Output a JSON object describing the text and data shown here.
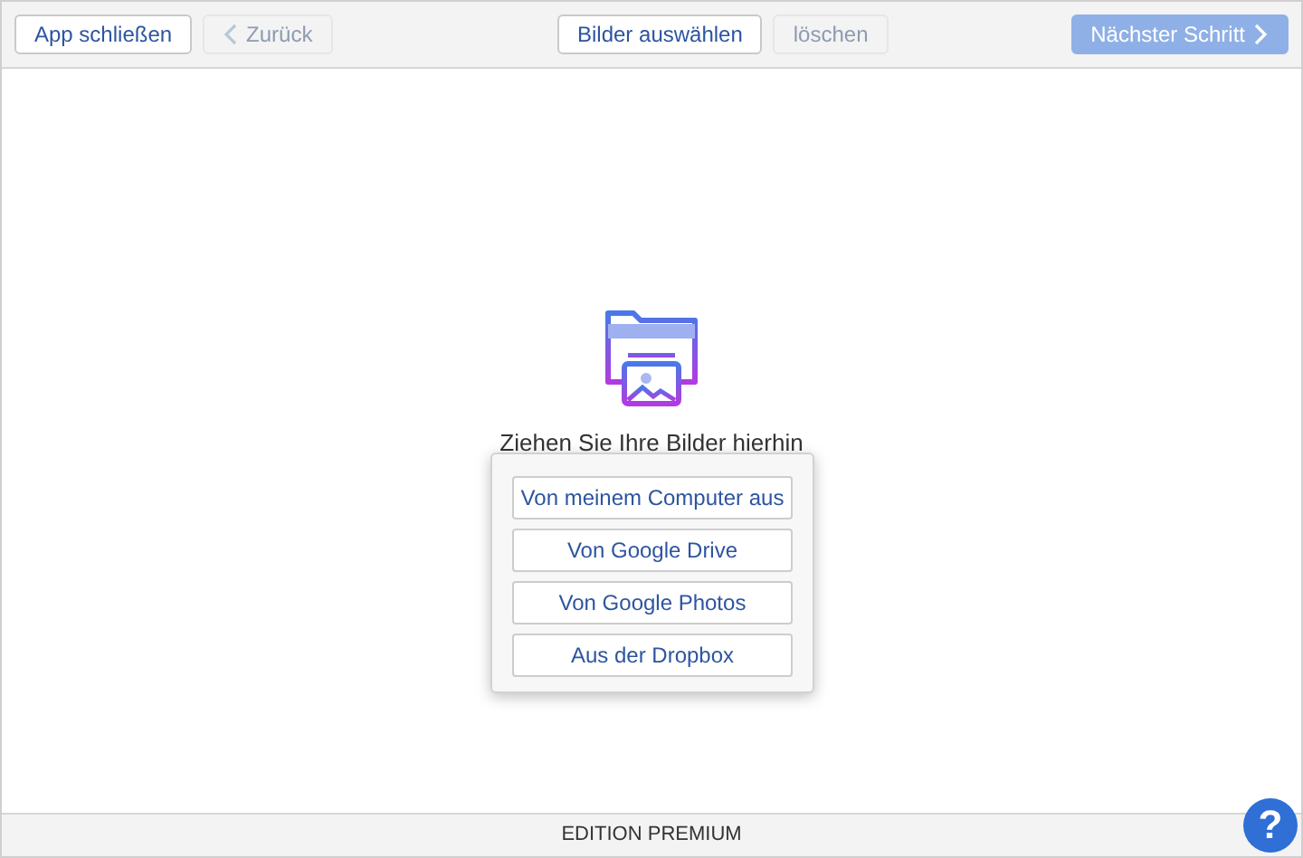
{
  "toolbar": {
    "left": [
      {
        "label": "App schließen",
        "disabled": false
      },
      {
        "label": "Zurück",
        "disabled": true,
        "kind": "back"
      }
    ],
    "center": [
      {
        "label": "Bilder auswählen",
        "disabled": false
      },
      {
        "label": "löschen",
        "disabled": true
      }
    ],
    "right": [
      {
        "label": "Nächster Schritt",
        "disabled": true,
        "kind": "next"
      }
    ]
  },
  "drop_zone": {
    "hint": "Ziehen Sie Ihre Bilder hierhin"
  },
  "source_menu": {
    "items": [
      "Von meinem Computer aus",
      "Von Google Drive",
      "Von Google Photos",
      "Aus der Dropbox"
    ]
  },
  "status_bar": {
    "text": "EDITION PREMIUM"
  },
  "help_button": {
    "label": "?"
  }
}
